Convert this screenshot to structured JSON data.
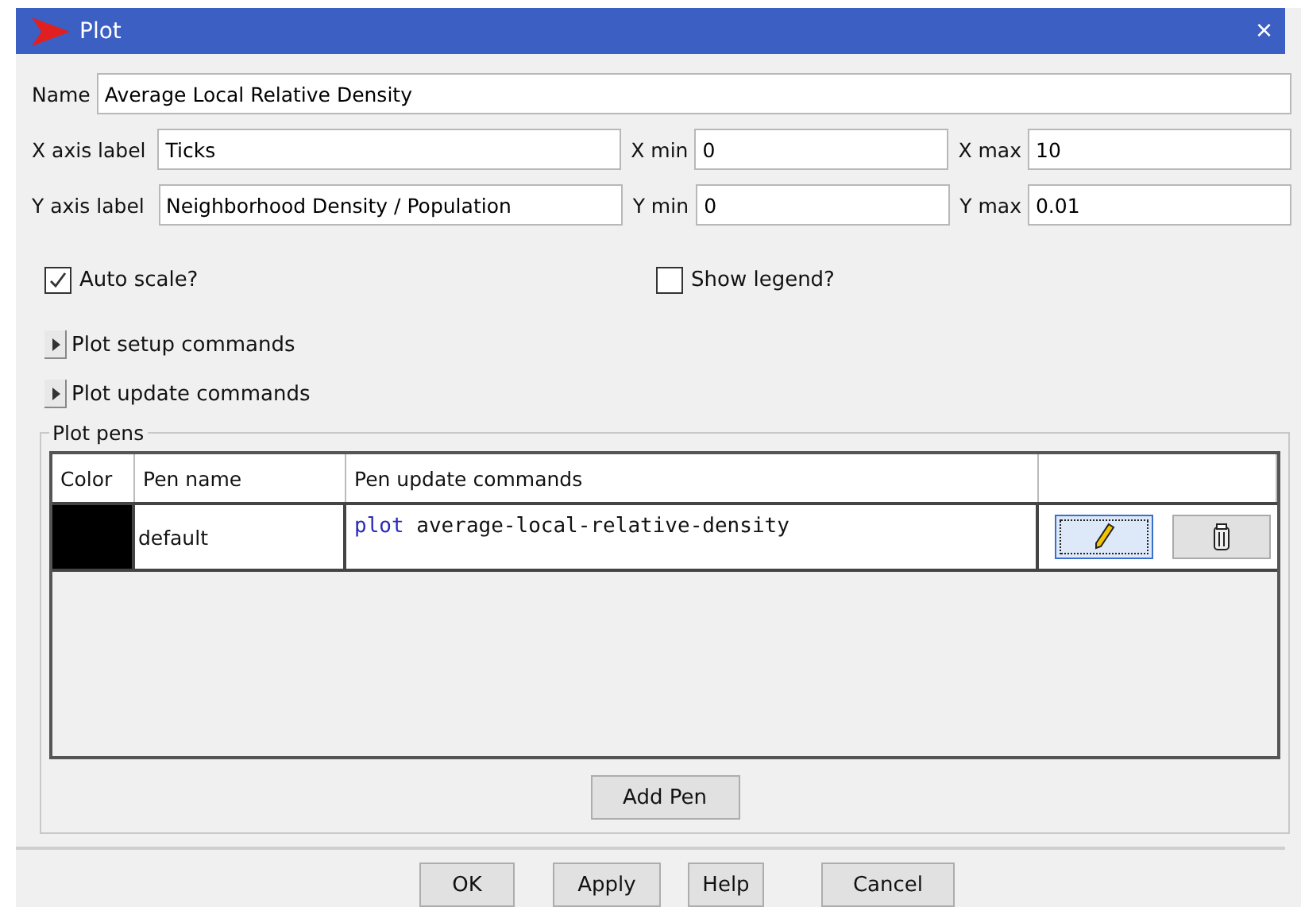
{
  "window": {
    "title": "Plot",
    "close": "×"
  },
  "name": {
    "label": "Name",
    "value": "Average Local Relative Density"
  },
  "axes": [
    {
      "label": "X axis label",
      "value": "Ticks",
      "min_label": "X min",
      "min": "0",
      "max_label": "X max",
      "max": "10"
    },
    {
      "label": "Y axis label",
      "value": "Neighborhood Density / Population",
      "min_label": "Y min",
      "min": "0",
      "max_label": "Y max",
      "max": "0.01"
    }
  ],
  "options": [
    {
      "label": "Auto scale?",
      "checked": true
    },
    {
      "label": "Show legend?",
      "checked": false
    }
  ],
  "sections": [
    {
      "label": "Plot setup commands",
      "expanded": false
    },
    {
      "label": "Plot update commands",
      "expanded": false
    }
  ],
  "plot_pens": {
    "title": "Plot pens",
    "columns": [
      "Color",
      "Pen name",
      "Pen update commands"
    ],
    "rows": [
      {
        "color": "#000000",
        "name": "default",
        "command": "plot average-local-relative-density"
      }
    ],
    "add_button": "Add Pen"
  },
  "buttons": [
    "OK",
    "Apply",
    "Help",
    "Cancel"
  ]
}
